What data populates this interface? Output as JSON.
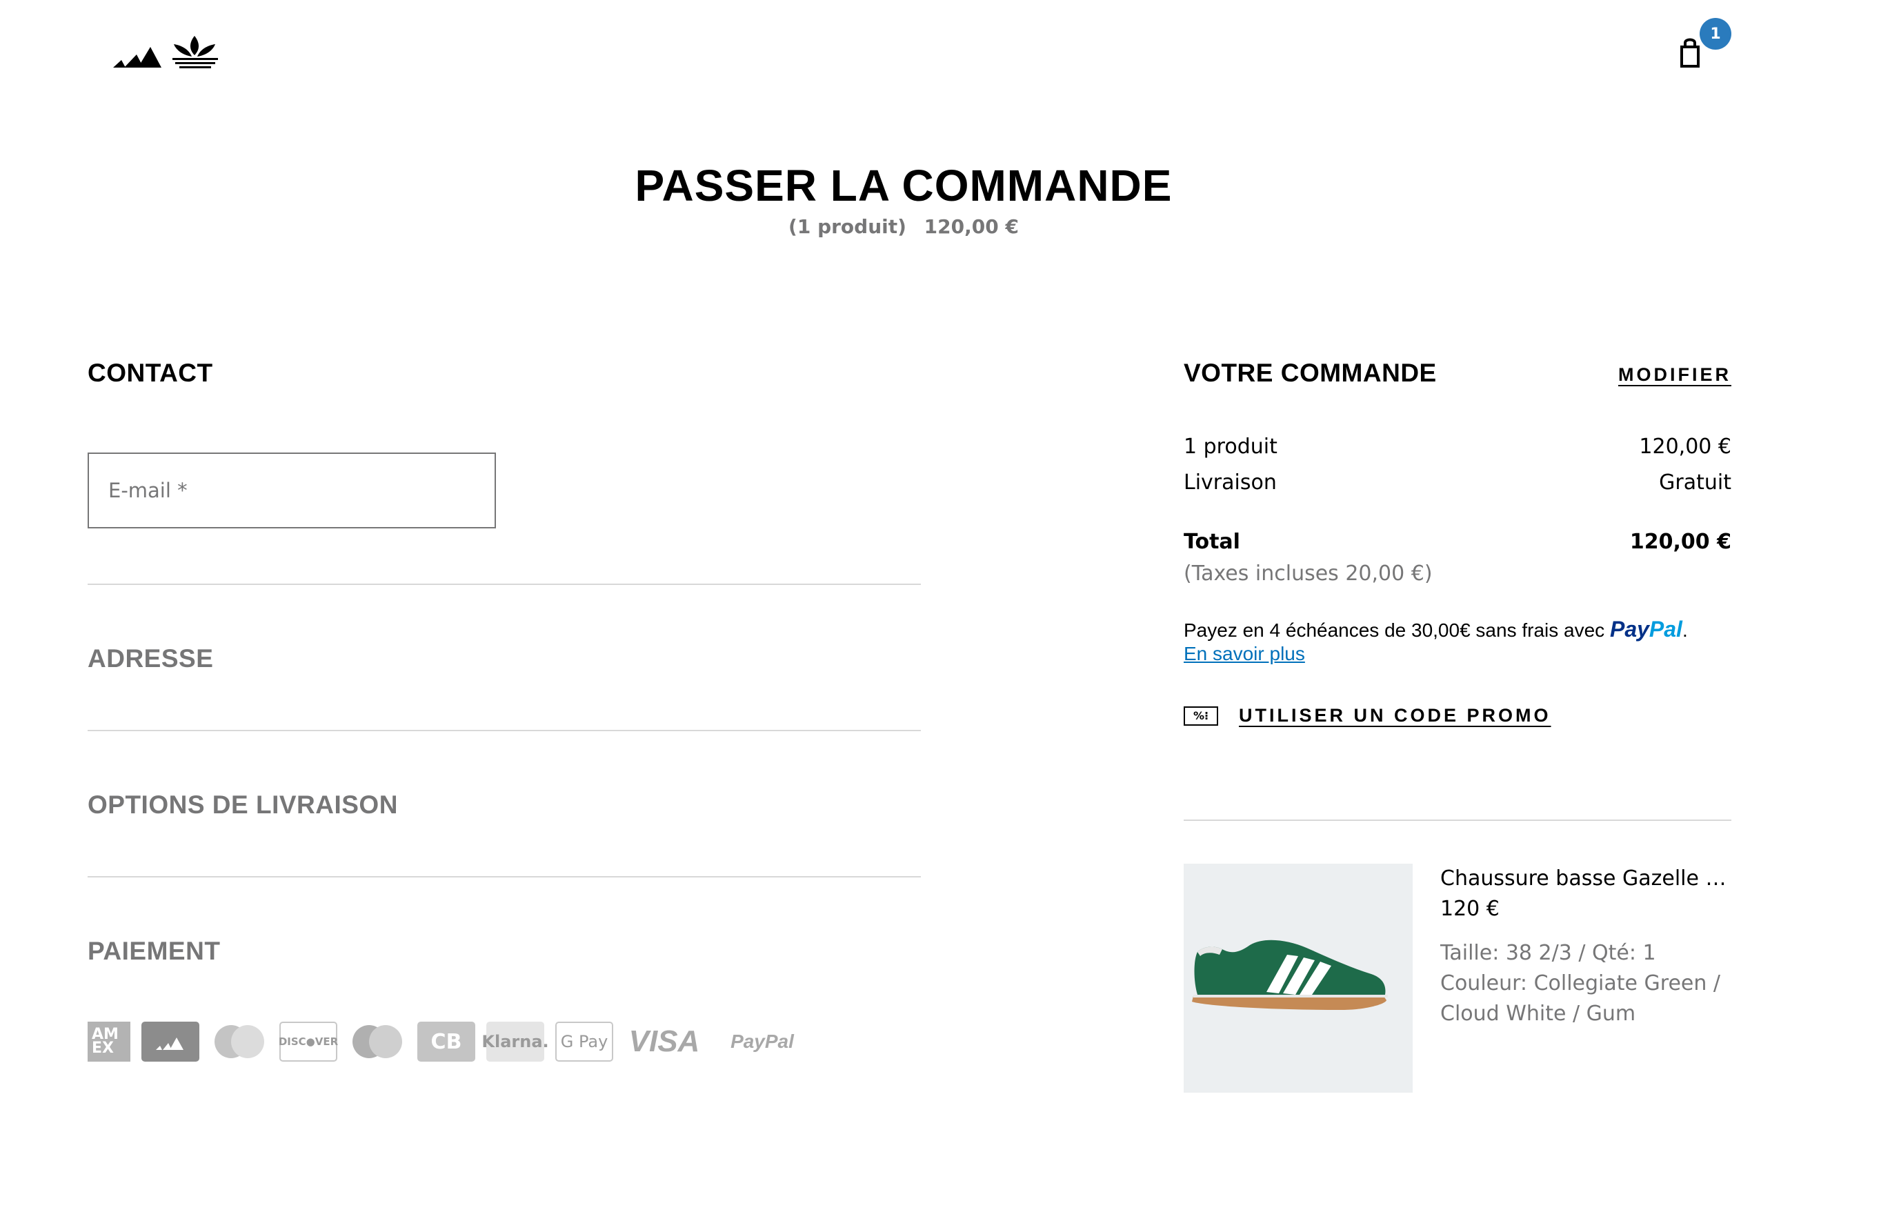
{
  "header": {
    "logo_alt": "adidas",
    "cart_count": "1"
  },
  "page": {
    "title": "PASSER LA COMMANDE",
    "sub_count": "(1 produit)",
    "sub_price": "120,00 €"
  },
  "contact": {
    "heading": "CONTACT",
    "email_placeholder": "E-mail *",
    "email_value": ""
  },
  "sections": {
    "address": "ADRESSE",
    "shipping": "OPTIONS DE LIVRAISON",
    "payment": "PAIEMENT"
  },
  "payment_methods": {
    "amex": "AM EX",
    "discover": "DISC●VER",
    "cb": "CB",
    "klarna": "Klarna.",
    "gpay": "G Pay",
    "visa": "VISA",
    "paypal": "PayPal"
  },
  "order": {
    "heading": "VOTRE COMMANDE",
    "modify": "MODIFIER",
    "items_label": "1 produit",
    "items_value": "120,00 €",
    "shipping_label": "Livraison",
    "shipping_value": "Gratuit",
    "total_label": "Total",
    "total_value": "120,00 €",
    "taxes": "(Taxes incluses  20,00 €)",
    "paypal_text": "Payez en 4 échéances de 30,00€ sans frais avec ",
    "paypal_logo_a": "Pay",
    "paypal_logo_b": "Pal",
    "paypal_period": ".",
    "learn_more": "En savoir plus",
    "promo_icon": "%⁝",
    "promo": "UTILISER UN CODE PROMO"
  },
  "product": {
    "name": "Chaussure basse Gazelle Indoor",
    "price": "120 €",
    "size_qty": "Taille: 38 2/3 / Qté: 1",
    "color": "Couleur: Collegiate Green / Cloud White / Gum"
  },
  "colors": {
    "badge": "#2a7bbd",
    "grey_text": "#767677",
    "shoe_green": "#1e6b4a",
    "sole_gum": "#c58a55",
    "paypal_dark": "#003087",
    "paypal_light": "#009cde",
    "link": "#0070ba"
  }
}
